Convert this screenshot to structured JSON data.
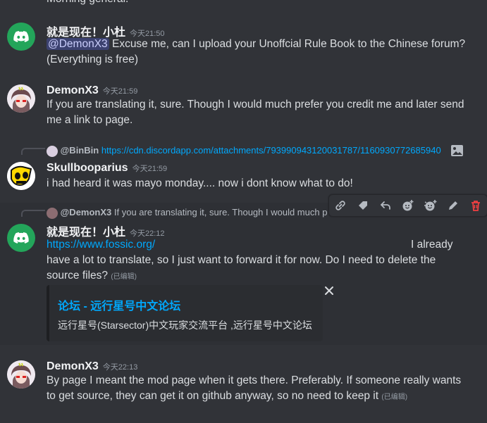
{
  "top_cut_text": "Morning general.",
  "messages": [
    {
      "author": "就是现在！小杜",
      "time": "今天21:50",
      "mention": "@DemonX3",
      "text_after_mention": " Excuse me, can I upload your Unoffcial Rule Book to the Chinese forum?",
      "line2": "(Everything is free)"
    },
    {
      "author": "DemonX3",
      "time": "今天21:59",
      "line1": "If you are translating it, sure. Though I would much prefer you credit me and later send",
      "line2": "me a link to page."
    },
    {
      "reply_author": "@BinBin",
      "reply_link": "https://cdn.discordapp.com/attachments/793990943120031787/1160930772685940",
      "author": "Skullbooparius",
      "time": "今天21:59",
      "text": "i had heard it was mayo monday.... now i dont know what to do!"
    },
    {
      "reply_author": "@DemonX3",
      "reply_text": "If you are translating it, sure. Though I would much p",
      "author": "就是现在！小杜",
      "time": "今天22:12",
      "link": "https://www.fossic.org/",
      "tail": "I already",
      "line2": "have a lot to translate, so I just want to forward it for now. Do I need to delete the",
      "line3": "source files?",
      "edited": "(已编辑)",
      "embed_title": "论坛 - 远行星号中文论坛",
      "embed_desc": "远行星号(Starsector)中文玩家交流平台 ,远行星号中文论坛"
    },
    {
      "author": "DemonX3",
      "time": "今天22:13",
      "line1": "By page I meant the mod page when it gets there. Preferably. If someone really wants",
      "line2": "to get source, they can get it on github anyway, so no need to keep it",
      "edited": "(已编辑)"
    }
  ],
  "toolbar": [
    "link-icon",
    "tag-icon",
    "reply-icon",
    "add-reaction-icon",
    "add-super-reaction-icon",
    "edit-icon",
    "delete-icon"
  ],
  "colors": {
    "background": "#313338",
    "link": "#00a8fc",
    "discord_blurple": "#23a55a",
    "delete": "#f23f42"
  }
}
